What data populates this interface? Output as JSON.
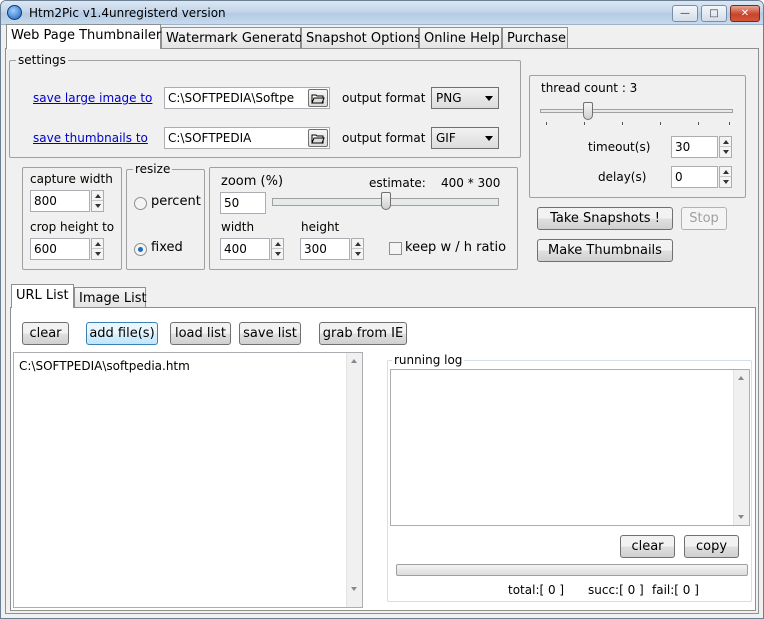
{
  "window": {
    "title": "Htm2Pic v1.4",
    "subtitle": "unregisterd version",
    "controls": {
      "minimize": "—",
      "maximize": "□",
      "close": "✕"
    }
  },
  "main_tabs": [
    {
      "label": "Web Page Thumbnailer",
      "active": true
    },
    {
      "label": "Watermark Generator",
      "active": false
    },
    {
      "label": "Snapshot Options",
      "active": false
    },
    {
      "label": "Online Help",
      "active": false
    },
    {
      "label": "Purchase",
      "active": false
    }
  ],
  "settings": {
    "label": "settings",
    "large_image": {
      "link": "save large image to",
      "path": "C:\\SOFTPEDIA\\Softpe",
      "format_label": "output format",
      "format": "PNG"
    },
    "thumbnails": {
      "link": "save thumbnails to",
      "path": "C:\\SOFTPEDIA",
      "format_label": "output format",
      "format": "GIF"
    }
  },
  "thread": {
    "label": "thread count : 3",
    "level_fraction": 0.25,
    "timeout_label": "timeout(s)",
    "timeout": "30",
    "delay_label": "delay(s)",
    "delay": "0"
  },
  "capture": {
    "width_label": "capture width",
    "width": "800",
    "height_label": "crop height to",
    "height": "600"
  },
  "resize": {
    "label": "resize",
    "percent": "percent",
    "fixed": "fixed",
    "selected": "fixed"
  },
  "zoom": {
    "label": "zoom (%)",
    "value": "50",
    "estimate_label": "estimate:",
    "estimate": "400 * 300",
    "slider_fraction": 0.5,
    "width_label": "width",
    "width": "400",
    "height_label": "height",
    "height": "300",
    "ratio_label": "keep w / h ratio"
  },
  "actions": {
    "take": "Take Snapshots !",
    "stop": "Stop",
    "make": "Make Thumbnails"
  },
  "lower_tabs": [
    {
      "label": "URL List",
      "active": true
    },
    {
      "label": "Image List",
      "active": false
    }
  ],
  "list_buttons": {
    "clear": "clear",
    "add": "add file(s)",
    "load": "load list",
    "save": "save list",
    "grab": "grab from IE"
  },
  "url_list": [
    "C:\\SOFTPEDIA\\softpedia.htm"
  ],
  "log": {
    "label": "running log",
    "clear": "clear",
    "copy": "copy",
    "total": "total:[ 0 ]",
    "succ": "succ:[ 0 ]",
    "fail": "fail:[ 0 ]"
  }
}
